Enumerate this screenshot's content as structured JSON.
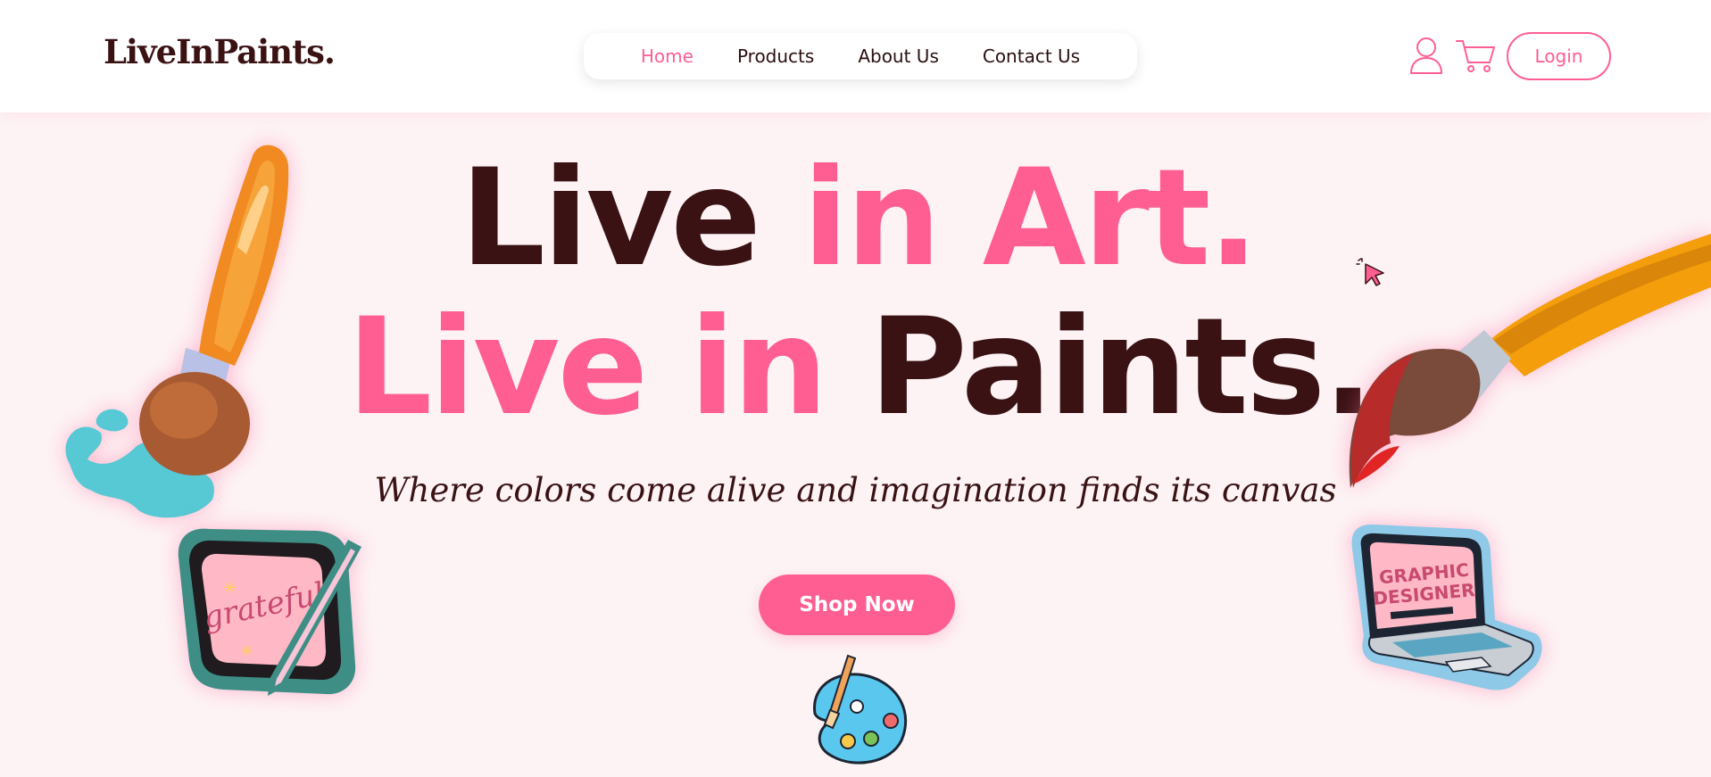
{
  "header": {
    "logo": "LiveInPaints.",
    "nav": [
      {
        "label": "Home",
        "active": true
      },
      {
        "label": "Products",
        "active": false
      },
      {
        "label": "About Us",
        "active": false
      },
      {
        "label": "Contact Us",
        "active": false
      }
    ],
    "icons": [
      "user-icon",
      "cart-icon"
    ],
    "login_label": "Login"
  },
  "hero": {
    "line1": {
      "dark": "Live ",
      "pink": "in Art."
    },
    "line2": {
      "pink": "Live in ",
      "dark": "Paints."
    },
    "tagline": "Where colors come alive and imagination finds its canvas",
    "cta_label": "Shop Now"
  },
  "stickers": {
    "tablet_text": "grateful",
    "laptop_text_1": "GRAPHIC",
    "laptop_text_2": "DESIGNER"
  },
  "colors": {
    "accent": "#ff5e93",
    "dark_text": "#3a1214",
    "background": "#fdf3f5",
    "header_bg": "#ffffff"
  }
}
